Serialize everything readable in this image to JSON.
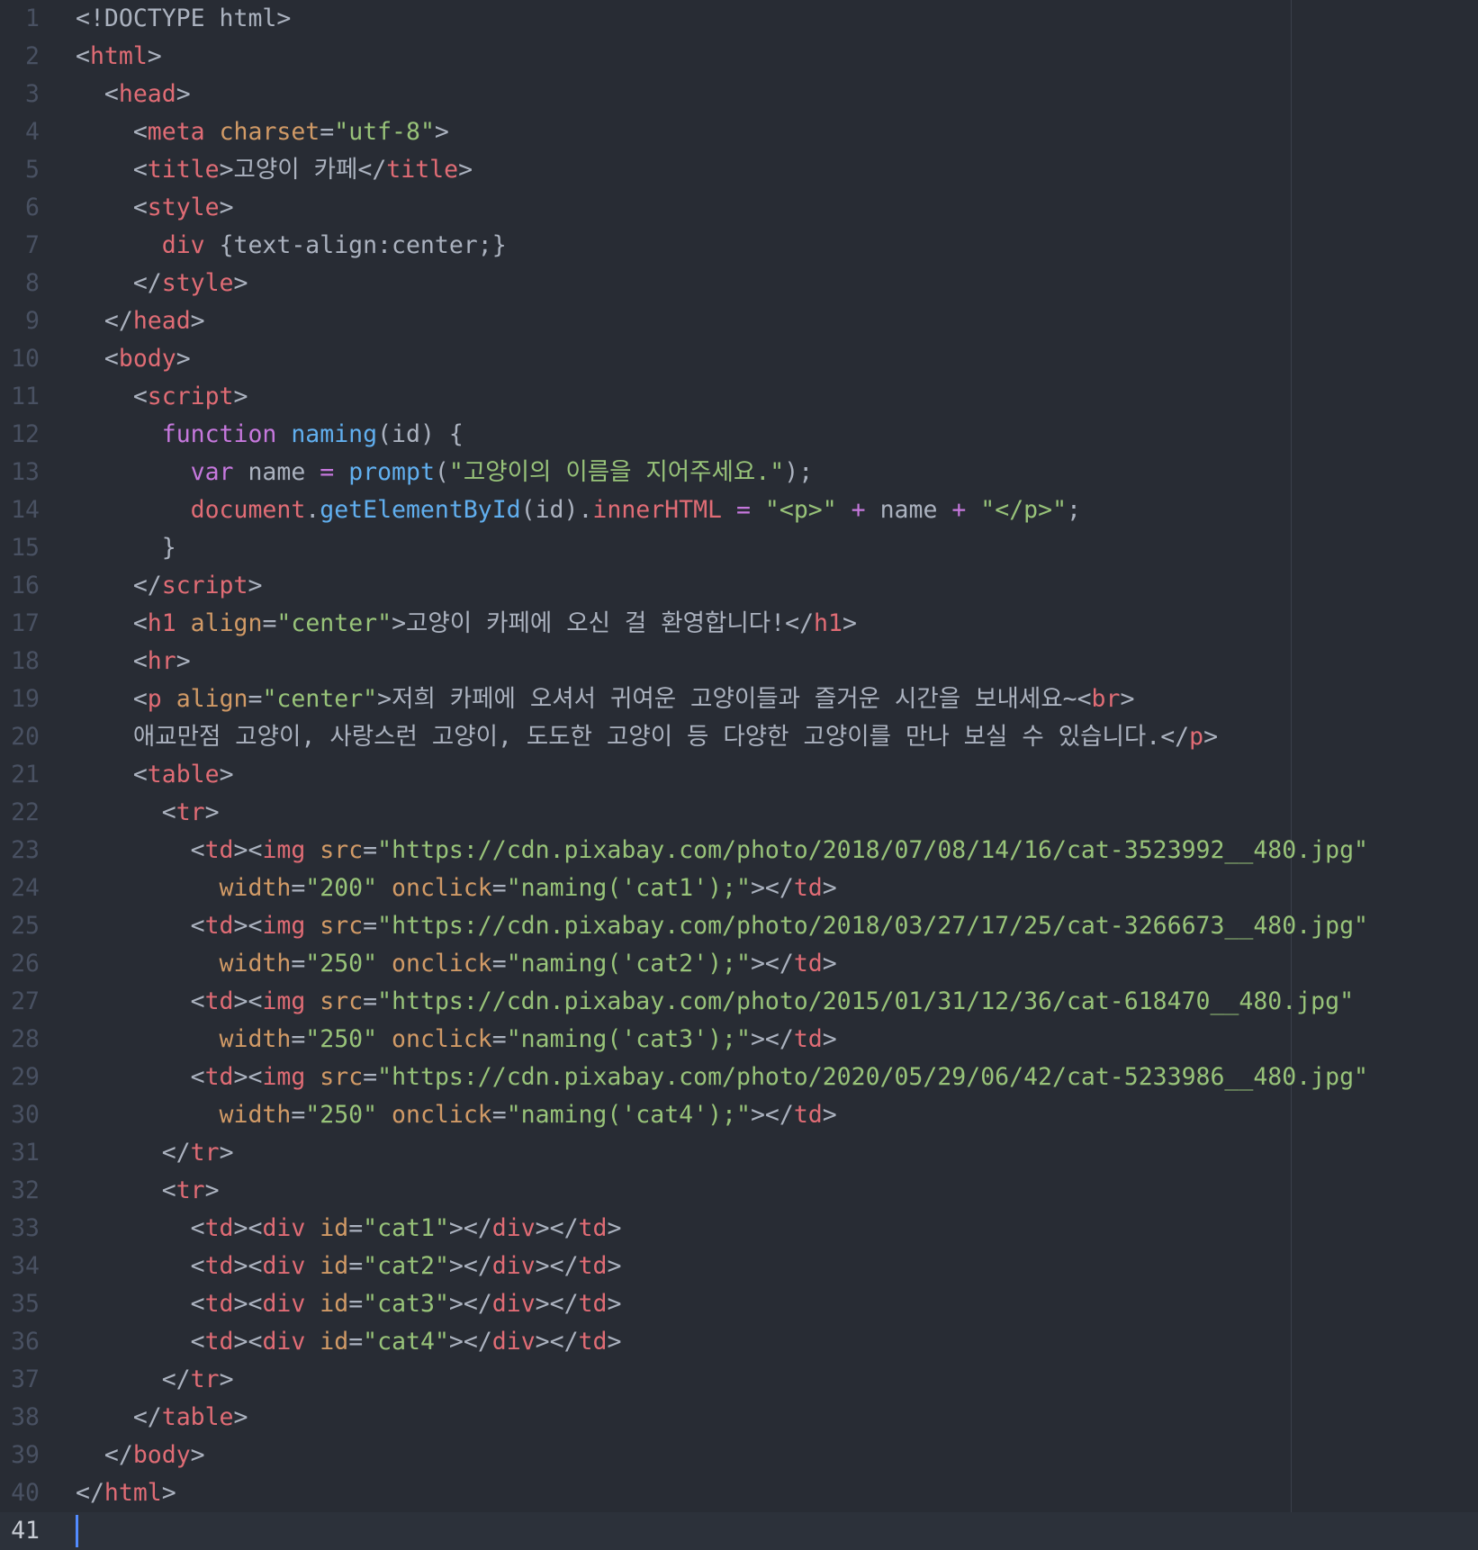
{
  "editor": {
    "theme": "One Dark",
    "colors": {
      "background": "#282c34",
      "plain": "#abb2bf",
      "tag": "#e06c75",
      "attribute": "#d19a66",
      "string": "#98c379",
      "keyword": "#c678dd",
      "function": "#61afef",
      "gutter": "#495162",
      "cursor": "#528bff"
    },
    "active_line": 41,
    "lines": [
      {
        "n": "1",
        "segs": [
          [
            "pl",
            "<!DOCTYPE html>"
          ]
        ]
      },
      {
        "n": "2",
        "segs": [
          [
            "pl",
            "<"
          ],
          [
            "tg",
            "html"
          ],
          [
            "pl",
            ">"
          ]
        ]
      },
      {
        "n": "3",
        "segs": [
          [
            "pl",
            "  <"
          ],
          [
            "tg",
            "head"
          ],
          [
            "pl",
            ">"
          ]
        ]
      },
      {
        "n": "4",
        "segs": [
          [
            "pl",
            "    <"
          ],
          [
            "tg",
            "meta"
          ],
          [
            "pl",
            " "
          ],
          [
            "at",
            "charset"
          ],
          [
            "pl",
            "="
          ],
          [
            "st",
            "\"utf-8\""
          ],
          [
            "pl",
            ">"
          ]
        ]
      },
      {
        "n": "5",
        "segs": [
          [
            "pl",
            "    <"
          ],
          [
            "tg",
            "title"
          ],
          [
            "pl",
            ">고양이 카페</"
          ],
          [
            "tg",
            "title"
          ],
          [
            "pl",
            ">"
          ]
        ]
      },
      {
        "n": "6",
        "segs": [
          [
            "pl",
            "    <"
          ],
          [
            "tg",
            "style"
          ],
          [
            "pl",
            ">"
          ]
        ]
      },
      {
        "n": "7",
        "segs": [
          [
            "pl",
            "      "
          ],
          [
            "tg",
            "div"
          ],
          [
            "pl",
            " {text-align:center;}"
          ]
        ]
      },
      {
        "n": "8",
        "segs": [
          [
            "pl",
            "    </"
          ],
          [
            "tg",
            "style"
          ],
          [
            "pl",
            ">"
          ]
        ]
      },
      {
        "n": "9",
        "segs": [
          [
            "pl",
            "  </"
          ],
          [
            "tg",
            "head"
          ],
          [
            "pl",
            ">"
          ]
        ]
      },
      {
        "n": "10",
        "segs": [
          [
            "pl",
            "  <"
          ],
          [
            "tg",
            "body"
          ],
          [
            "pl",
            ">"
          ]
        ]
      },
      {
        "n": "11",
        "segs": [
          [
            "pl",
            "    <"
          ],
          [
            "tg",
            "script"
          ],
          [
            "pl",
            ">"
          ]
        ]
      },
      {
        "n": "12",
        "segs": [
          [
            "pl",
            "      "
          ],
          [
            "kw",
            "function"
          ],
          [
            "pl",
            " "
          ],
          [
            "fn",
            "naming"
          ],
          [
            "pl",
            "(id) {"
          ]
        ]
      },
      {
        "n": "13",
        "segs": [
          [
            "pl",
            "        "
          ],
          [
            "kw",
            "var"
          ],
          [
            "pl",
            " name "
          ],
          [
            "op",
            "="
          ],
          [
            "pl",
            " "
          ],
          [
            "fn",
            "prompt"
          ],
          [
            "pl",
            "("
          ],
          [
            "st",
            "\"고양이의 이름을 지어주세요.\""
          ],
          [
            "pl",
            ");"
          ]
        ]
      },
      {
        "n": "14",
        "segs": [
          [
            "pl",
            "        "
          ],
          [
            "va",
            "document"
          ],
          [
            "pl",
            "."
          ],
          [
            "fn",
            "getElementById"
          ],
          [
            "pl",
            "(id)."
          ],
          [
            "va",
            "innerHTML"
          ],
          [
            "pl",
            " "
          ],
          [
            "op",
            "="
          ],
          [
            "pl",
            " "
          ],
          [
            "st",
            "\"<p>\""
          ],
          [
            "pl",
            " "
          ],
          [
            "op",
            "+"
          ],
          [
            "pl",
            " name "
          ],
          [
            "op",
            "+"
          ],
          [
            "pl",
            " "
          ],
          [
            "st",
            "\"</p>\""
          ],
          [
            "pl",
            ";"
          ]
        ]
      },
      {
        "n": "15",
        "segs": [
          [
            "pl",
            "      }"
          ]
        ]
      },
      {
        "n": "16",
        "segs": [
          [
            "pl",
            "    </"
          ],
          [
            "tg",
            "script"
          ],
          [
            "pl",
            ">"
          ]
        ]
      },
      {
        "n": "17",
        "segs": [
          [
            "pl",
            "    <"
          ],
          [
            "tg",
            "h1"
          ],
          [
            "pl",
            " "
          ],
          [
            "at",
            "align"
          ],
          [
            "pl",
            "="
          ],
          [
            "st",
            "\"center\""
          ],
          [
            "pl",
            ">고양이 카페에 오신 걸 환영합니다!</"
          ],
          [
            "tg",
            "h1"
          ],
          [
            "pl",
            ">"
          ]
        ]
      },
      {
        "n": "18",
        "segs": [
          [
            "pl",
            "    <"
          ],
          [
            "tg",
            "hr"
          ],
          [
            "pl",
            ">"
          ]
        ]
      },
      {
        "n": "19",
        "segs": [
          [
            "pl",
            "    <"
          ],
          [
            "tg",
            "p"
          ],
          [
            "pl",
            " "
          ],
          [
            "at",
            "align"
          ],
          [
            "pl",
            "="
          ],
          [
            "st",
            "\"center\""
          ],
          [
            "pl",
            ">저희 카페에 오셔서 귀여운 고양이들과 즐거운 시간을 보내세요~<"
          ],
          [
            "tg",
            "br"
          ],
          [
            "pl",
            ">"
          ]
        ]
      },
      {
        "n": "20",
        "segs": [
          [
            "pl",
            "    애교만점 고양이, 사랑스런 고양이, 도도한 고양이 등 다양한 고양이를 만나 보실 수 있습니다.</"
          ],
          [
            "tg",
            "p"
          ],
          [
            "pl",
            ">"
          ]
        ]
      },
      {
        "n": "21",
        "segs": [
          [
            "pl",
            "    <"
          ],
          [
            "tg",
            "table"
          ],
          [
            "pl",
            ">"
          ]
        ]
      },
      {
        "n": "22",
        "segs": [
          [
            "pl",
            "      <"
          ],
          [
            "tg",
            "tr"
          ],
          [
            "pl",
            ">"
          ]
        ]
      },
      {
        "n": "23",
        "segs": [
          [
            "pl",
            "        <"
          ],
          [
            "tg",
            "td"
          ],
          [
            "pl",
            "><"
          ],
          [
            "tg",
            "img"
          ],
          [
            "pl",
            " "
          ],
          [
            "at",
            "src"
          ],
          [
            "pl",
            "="
          ],
          [
            "st",
            "\"https://cdn.pixabay.com/photo/2018/07/08/14/16/cat-3523992__480.jpg\""
          ]
        ]
      },
      {
        "n": "24",
        "segs": [
          [
            "pl",
            "          "
          ],
          [
            "at",
            "width"
          ],
          [
            "pl",
            "="
          ],
          [
            "st",
            "\"200\""
          ],
          [
            "pl",
            " "
          ],
          [
            "at",
            "onclick"
          ],
          [
            "pl",
            "="
          ],
          [
            "st",
            "\"naming('cat1');\""
          ],
          [
            "pl",
            "></"
          ],
          [
            "tg",
            "td"
          ],
          [
            "pl",
            ">"
          ]
        ]
      },
      {
        "n": "25",
        "segs": [
          [
            "pl",
            "        <"
          ],
          [
            "tg",
            "td"
          ],
          [
            "pl",
            "><"
          ],
          [
            "tg",
            "img"
          ],
          [
            "pl",
            " "
          ],
          [
            "at",
            "src"
          ],
          [
            "pl",
            "="
          ],
          [
            "st",
            "\"https://cdn.pixabay.com/photo/2018/03/27/17/25/cat-3266673__480.jpg\""
          ]
        ]
      },
      {
        "n": "26",
        "segs": [
          [
            "pl",
            "          "
          ],
          [
            "at",
            "width"
          ],
          [
            "pl",
            "="
          ],
          [
            "st",
            "\"250\""
          ],
          [
            "pl",
            " "
          ],
          [
            "at",
            "onclick"
          ],
          [
            "pl",
            "="
          ],
          [
            "st",
            "\"naming('cat2');\""
          ],
          [
            "pl",
            "></"
          ],
          [
            "tg",
            "td"
          ],
          [
            "pl",
            ">"
          ]
        ]
      },
      {
        "n": "27",
        "segs": [
          [
            "pl",
            "        <"
          ],
          [
            "tg",
            "td"
          ],
          [
            "pl",
            "><"
          ],
          [
            "tg",
            "img"
          ],
          [
            "pl",
            " "
          ],
          [
            "at",
            "src"
          ],
          [
            "pl",
            "="
          ],
          [
            "st",
            "\"https://cdn.pixabay.com/photo/2015/01/31/12/36/cat-618470__480.jpg\""
          ]
        ]
      },
      {
        "n": "28",
        "segs": [
          [
            "pl",
            "          "
          ],
          [
            "at",
            "width"
          ],
          [
            "pl",
            "="
          ],
          [
            "st",
            "\"250\""
          ],
          [
            "pl",
            " "
          ],
          [
            "at",
            "onclick"
          ],
          [
            "pl",
            "="
          ],
          [
            "st",
            "\"naming('cat3');\""
          ],
          [
            "pl",
            "></"
          ],
          [
            "tg",
            "td"
          ],
          [
            "pl",
            ">"
          ]
        ]
      },
      {
        "n": "29",
        "segs": [
          [
            "pl",
            "        <"
          ],
          [
            "tg",
            "td"
          ],
          [
            "pl",
            "><"
          ],
          [
            "tg",
            "img"
          ],
          [
            "pl",
            " "
          ],
          [
            "at",
            "src"
          ],
          [
            "pl",
            "="
          ],
          [
            "st",
            "\"https://cdn.pixabay.com/photo/2020/05/29/06/42/cat-5233986__480.jpg\""
          ]
        ]
      },
      {
        "n": "30",
        "segs": [
          [
            "pl",
            "          "
          ],
          [
            "at",
            "width"
          ],
          [
            "pl",
            "="
          ],
          [
            "st",
            "\"250\""
          ],
          [
            "pl",
            " "
          ],
          [
            "at",
            "onclick"
          ],
          [
            "pl",
            "="
          ],
          [
            "st",
            "\"naming('cat4');\""
          ],
          [
            "pl",
            "></"
          ],
          [
            "tg",
            "td"
          ],
          [
            "pl",
            ">"
          ]
        ]
      },
      {
        "n": "31",
        "segs": [
          [
            "pl",
            "      </"
          ],
          [
            "tg",
            "tr"
          ],
          [
            "pl",
            ">"
          ]
        ]
      },
      {
        "n": "32",
        "segs": [
          [
            "pl",
            "      <"
          ],
          [
            "tg",
            "tr"
          ],
          [
            "pl",
            ">"
          ]
        ]
      },
      {
        "n": "33",
        "segs": [
          [
            "pl",
            "        <"
          ],
          [
            "tg",
            "td"
          ],
          [
            "pl",
            "><"
          ],
          [
            "tg",
            "div"
          ],
          [
            "pl",
            " "
          ],
          [
            "at",
            "id"
          ],
          [
            "pl",
            "="
          ],
          [
            "st",
            "\"cat1\""
          ],
          [
            "pl",
            "></"
          ],
          [
            "tg",
            "div"
          ],
          [
            "pl",
            "></"
          ],
          [
            "tg",
            "td"
          ],
          [
            "pl",
            ">"
          ]
        ]
      },
      {
        "n": "34",
        "segs": [
          [
            "pl",
            "        <"
          ],
          [
            "tg",
            "td"
          ],
          [
            "pl",
            "><"
          ],
          [
            "tg",
            "div"
          ],
          [
            "pl",
            " "
          ],
          [
            "at",
            "id"
          ],
          [
            "pl",
            "="
          ],
          [
            "st",
            "\"cat2\""
          ],
          [
            "pl",
            "></"
          ],
          [
            "tg",
            "div"
          ],
          [
            "pl",
            "></"
          ],
          [
            "tg",
            "td"
          ],
          [
            "pl",
            ">"
          ]
        ]
      },
      {
        "n": "35",
        "segs": [
          [
            "pl",
            "        <"
          ],
          [
            "tg",
            "td"
          ],
          [
            "pl",
            "><"
          ],
          [
            "tg",
            "div"
          ],
          [
            "pl",
            " "
          ],
          [
            "at",
            "id"
          ],
          [
            "pl",
            "="
          ],
          [
            "st",
            "\"cat3\""
          ],
          [
            "pl",
            "></"
          ],
          [
            "tg",
            "div"
          ],
          [
            "pl",
            "></"
          ],
          [
            "tg",
            "td"
          ],
          [
            "pl",
            ">"
          ]
        ]
      },
      {
        "n": "36",
        "segs": [
          [
            "pl",
            "        <"
          ],
          [
            "tg",
            "td"
          ],
          [
            "pl",
            "><"
          ],
          [
            "tg",
            "div"
          ],
          [
            "pl",
            " "
          ],
          [
            "at",
            "id"
          ],
          [
            "pl",
            "="
          ],
          [
            "st",
            "\"cat4\""
          ],
          [
            "pl",
            "></"
          ],
          [
            "tg",
            "div"
          ],
          [
            "pl",
            "></"
          ],
          [
            "tg",
            "td"
          ],
          [
            "pl",
            ">"
          ]
        ]
      },
      {
        "n": "37",
        "segs": [
          [
            "pl",
            "      </"
          ],
          [
            "tg",
            "tr"
          ],
          [
            "pl",
            ">"
          ]
        ]
      },
      {
        "n": "38",
        "segs": [
          [
            "pl",
            "    </"
          ],
          [
            "tg",
            "table"
          ],
          [
            "pl",
            ">"
          ]
        ]
      },
      {
        "n": "39",
        "segs": [
          [
            "pl",
            "  </"
          ],
          [
            "tg",
            "body"
          ],
          [
            "pl",
            ">"
          ]
        ]
      },
      {
        "n": "40",
        "segs": [
          [
            "pl",
            "</"
          ],
          [
            "tg",
            "html"
          ],
          [
            "pl",
            ">"
          ]
        ]
      },
      {
        "n": "41",
        "segs": []
      }
    ]
  }
}
